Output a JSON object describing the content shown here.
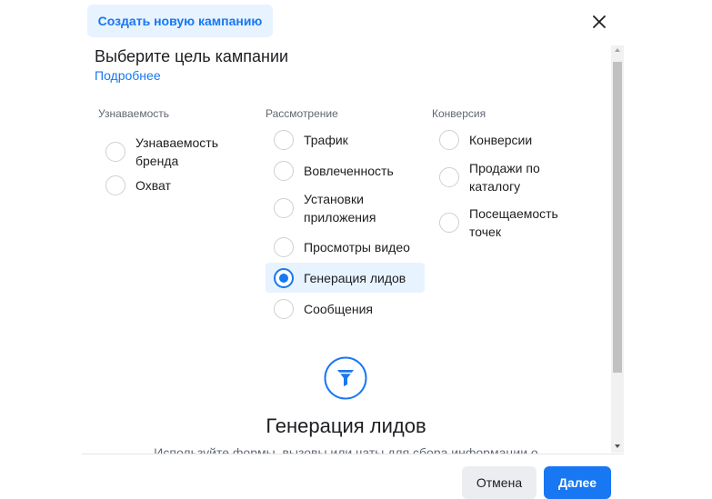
{
  "header": {
    "tab_label": "Создать новую кампанию",
    "close_icon": "close-icon"
  },
  "main": {
    "title": "Выберите цель кампании",
    "more_link": "Подробнее",
    "columns": [
      {
        "heading": "Узнаваемость",
        "options": [
          {
            "label_lines": [
              "Узнаваемость",
              "бренда"
            ],
            "selected": false
          },
          {
            "label_lines": [
              "Охват"
            ],
            "selected": false
          }
        ]
      },
      {
        "heading": "Рассмотрение",
        "options": [
          {
            "label_lines": [
              "Трафик"
            ],
            "selected": false
          },
          {
            "label_lines": [
              "Вовлеченность"
            ],
            "selected": false
          },
          {
            "label_lines": [
              "Установки",
              "приложения"
            ],
            "selected": false
          },
          {
            "label_lines": [
              "Просмотры видео"
            ],
            "selected": false
          },
          {
            "label_lines": [
              "Генерация лидов"
            ],
            "selected": true
          },
          {
            "label_lines": [
              "Сообщения"
            ],
            "selected": false
          }
        ]
      },
      {
        "heading": "Конверсия",
        "options": [
          {
            "label_lines": [
              "Конверсии"
            ],
            "selected": false
          },
          {
            "label_lines": [
              "Продажи по",
              "каталогу"
            ],
            "selected": false
          },
          {
            "label_lines": [
              "Посещаемость",
              "точек"
            ],
            "selected": false
          }
        ]
      }
    ],
    "detail": {
      "icon": "funnel-icon",
      "title": "Генерация лидов",
      "description": "Используйте формы, вызовы или чаты для сбора информации о"
    }
  },
  "footer": {
    "cancel_label": "Отмена",
    "next_label": "Далее"
  },
  "colors": {
    "accent": "#1877f2",
    "selected_bg": "#e7f3ff",
    "secondary_button": "#ebedf0"
  }
}
